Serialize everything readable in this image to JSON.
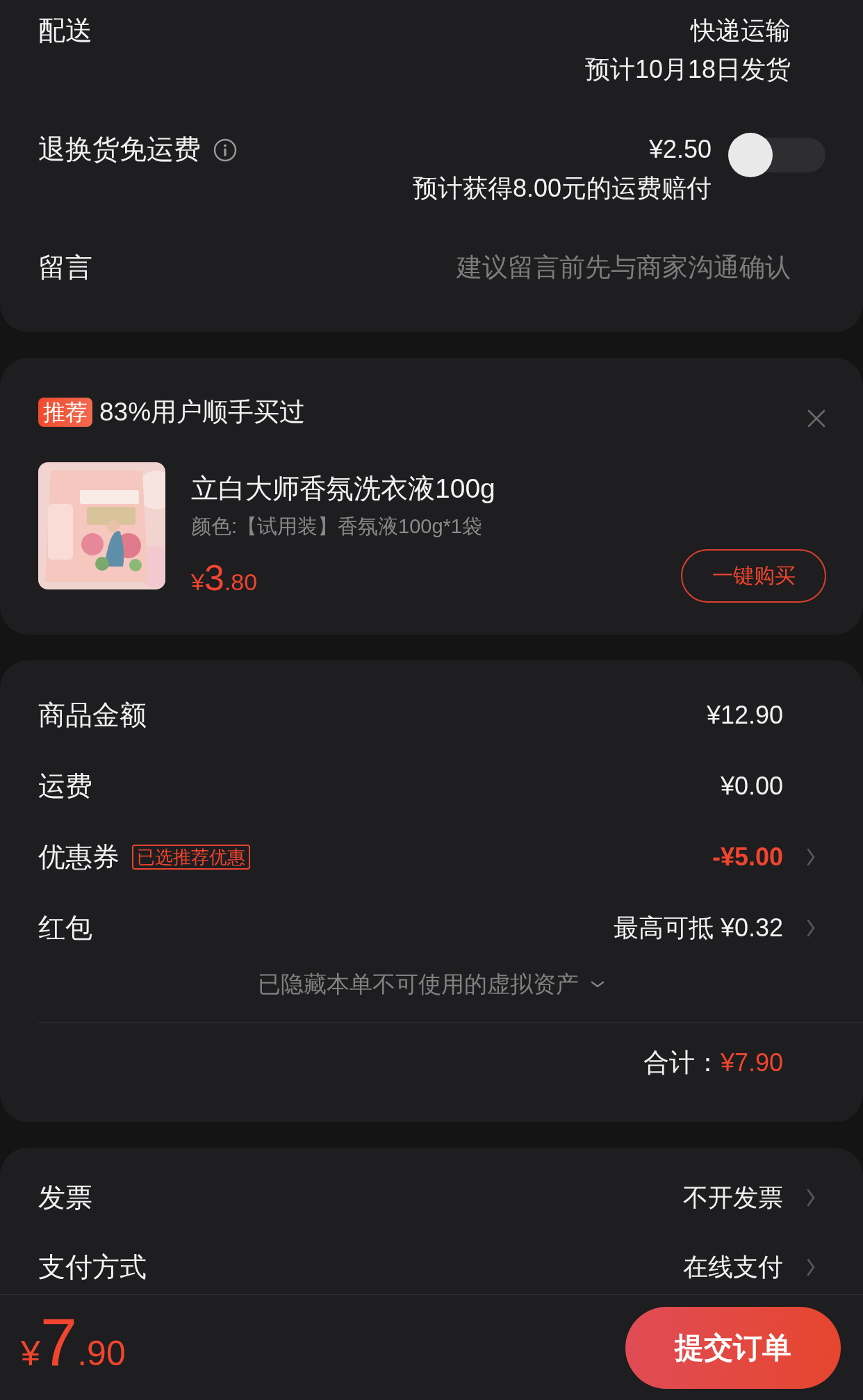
{
  "delivery": {
    "shipping": {
      "label": "配送",
      "method": "快递运输",
      "eta": "预计10月18日发货"
    },
    "return_insurance": {
      "label": "退换货免运费",
      "price": "¥2.50",
      "note": "预计获得8.00元的运费赔付",
      "on": false
    },
    "message": {
      "label": "留言",
      "placeholder": "建议留言前先与商家沟通确认"
    }
  },
  "recommendation": {
    "badge": "推荐",
    "title": "83%用户顺手买过",
    "product": {
      "name": "立白大师香氛洗衣液100g",
      "variant": "颜色:【试用装】香氛液100g*1袋",
      "price_symbol": "¥",
      "price_integer": "3",
      "price_decimal": ".80"
    },
    "buy_button": "一键购买"
  },
  "summary": {
    "rows": [
      {
        "kind": "amount",
        "label": "商品金额",
        "value": "¥12.90",
        "emphasis": false
      },
      {
        "kind": "amount",
        "label": "运费",
        "value": "¥0.00",
        "emphasis": false
      },
      {
        "kind": "option",
        "label": "优惠券",
        "tag": "已选推荐优惠",
        "value": "-¥5.00",
        "emphasis": true
      },
      {
        "kind": "option",
        "label": "红包",
        "value": "最高可抵 ¥0.32",
        "emphasis": false
      }
    ],
    "hidden_assets": "已隐藏本单不可使用的虚拟资产",
    "total": {
      "label": "合计：",
      "value": "¥7.90"
    }
  },
  "invoice": {
    "rows": [
      {
        "kind": "option",
        "label": "发票",
        "value": "不开发票"
      },
      {
        "kind": "option",
        "label": "支付方式",
        "value": "在线支付"
      }
    ]
  },
  "bottom_bar": {
    "price_symbol": "¥",
    "price_integer": "7",
    "price_decimal": ".90",
    "submit": "提交订单"
  }
}
